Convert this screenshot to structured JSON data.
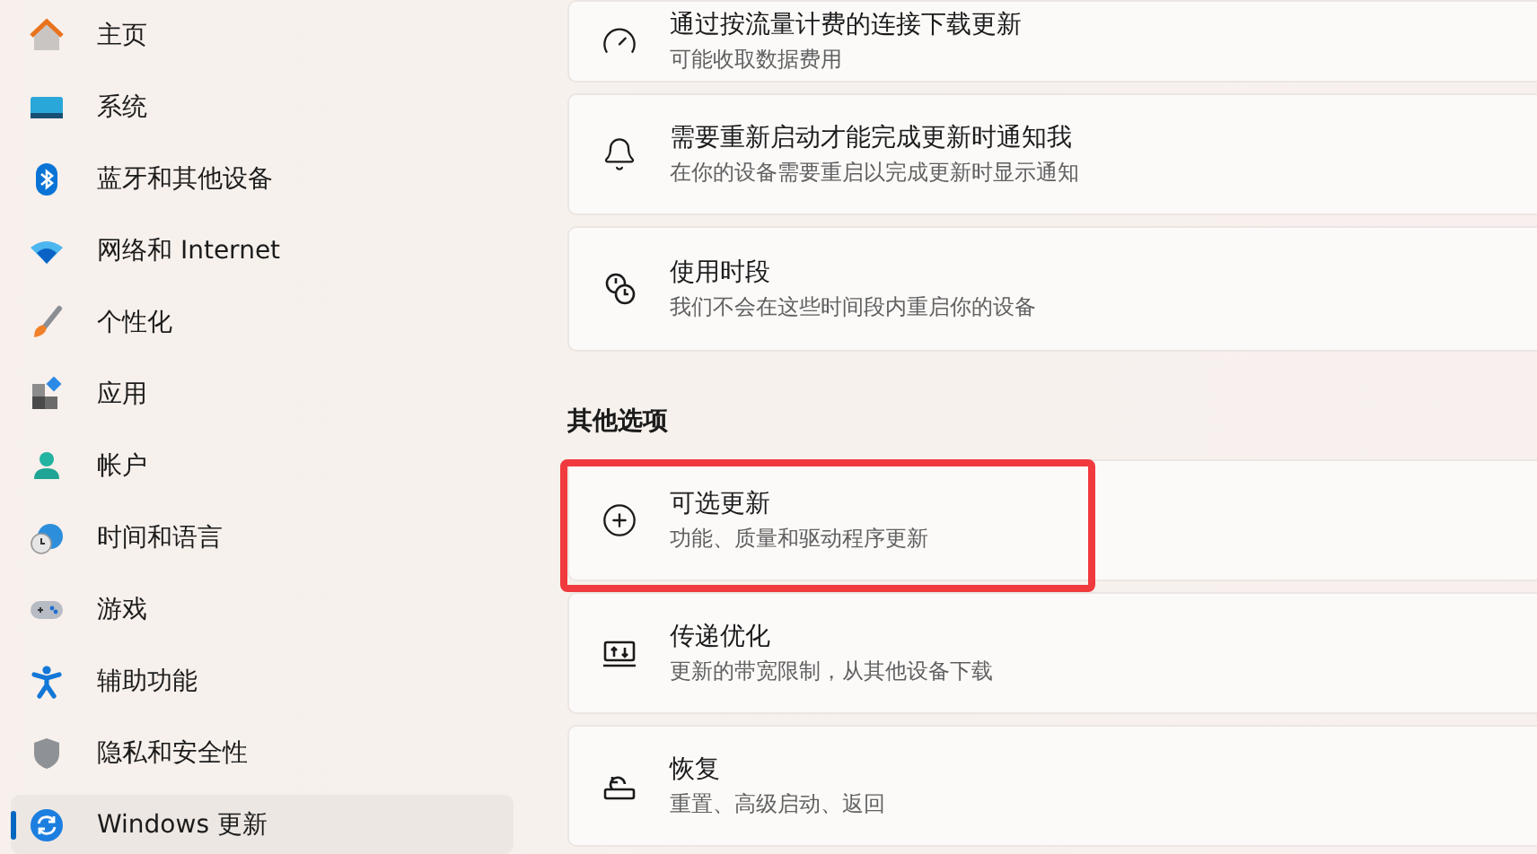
{
  "sidebar": {
    "items": [
      {
        "label": "主页",
        "selected": false
      },
      {
        "label": "系统",
        "selected": false
      },
      {
        "label": "蓝牙和其他设备",
        "selected": false
      },
      {
        "label": "网络和 Internet",
        "selected": false
      },
      {
        "label": "个性化",
        "selected": false
      },
      {
        "label": "应用",
        "selected": false
      },
      {
        "label": "帐户",
        "selected": false
      },
      {
        "label": "时间和语言",
        "selected": false
      },
      {
        "label": "游戏",
        "selected": false
      },
      {
        "label": "辅助功能",
        "selected": false
      },
      {
        "label": "隐私和安全性",
        "selected": false
      },
      {
        "label": "Windows 更新",
        "selected": true
      }
    ]
  },
  "cards_top": [
    {
      "title": "通过按流量计费的连接下载更新",
      "subtitle": "可能收取数据费用",
      "highlighted": false
    },
    {
      "title": "需要重新启动才能完成更新时通知我",
      "subtitle": "在你的设备需要重启以完成更新时显示通知",
      "highlighted": false
    },
    {
      "title": "使用时段",
      "subtitle": "我们不会在这些时间段内重启你的设备",
      "highlighted": false
    }
  ],
  "section_heading": "其他选项",
  "cards_other": [
    {
      "title": "可选更新",
      "subtitle": "功能、质量和驱动程序更新",
      "highlighted": true
    },
    {
      "title": "传递优化",
      "subtitle": "更新的带宽限制，从其他设备下载",
      "highlighted": false
    },
    {
      "title": "恢复",
      "subtitle": "重置、高级启动、返回",
      "highlighted": false
    }
  ]
}
